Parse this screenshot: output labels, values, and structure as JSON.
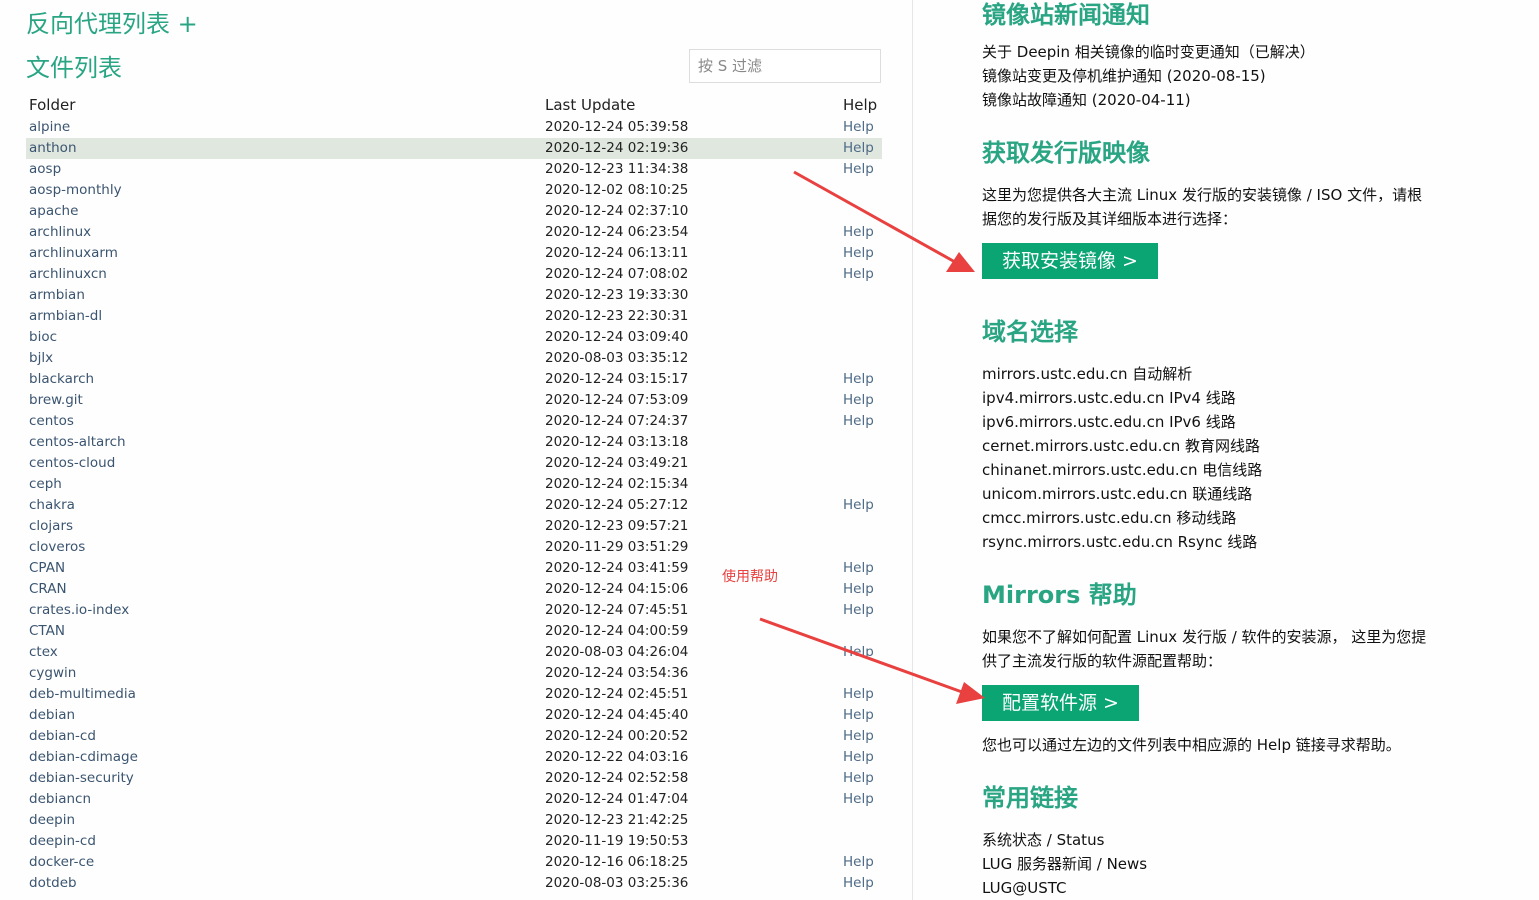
{
  "left": {
    "proxy_title": "反向代理列表 +",
    "files_title": "文件列表",
    "filter_placeholder": "按 S 过滤",
    "headers": {
      "folder": "Folder",
      "last_update": "Last Update",
      "help": "Help"
    },
    "rows": [
      {
        "folder": "alpine",
        "date": "2020-12-24 05:39:58",
        "help": "Help"
      },
      {
        "folder": "anthon",
        "date": "2020-12-24 02:19:36",
        "help": "Help"
      },
      {
        "folder": "aosp",
        "date": "2020-12-23 11:34:38",
        "help": "Help"
      },
      {
        "folder": "aosp-monthly",
        "date": "2020-12-02 08:10:25",
        "help": ""
      },
      {
        "folder": "apache",
        "date": "2020-12-24 02:37:10",
        "help": ""
      },
      {
        "folder": "archlinux",
        "date": "2020-12-24 06:23:54",
        "help": "Help"
      },
      {
        "folder": "archlinuxarm",
        "date": "2020-12-24 06:13:11",
        "help": "Help"
      },
      {
        "folder": "archlinuxcn",
        "date": "2020-12-24 07:08:02",
        "help": "Help"
      },
      {
        "folder": "armbian",
        "date": "2020-12-23 19:33:30",
        "help": ""
      },
      {
        "folder": "armbian-dl",
        "date": "2020-12-23 22:30:31",
        "help": ""
      },
      {
        "folder": "bioc",
        "date": "2020-12-24 03:09:40",
        "help": ""
      },
      {
        "folder": "bjlx",
        "date": "2020-08-03 03:35:12",
        "help": ""
      },
      {
        "folder": "blackarch",
        "date": "2020-12-24 03:15:17",
        "help": "Help"
      },
      {
        "folder": "brew.git",
        "date": "2020-12-24 07:53:09",
        "help": "Help"
      },
      {
        "folder": "centos",
        "date": "2020-12-24 07:24:37",
        "help": "Help"
      },
      {
        "folder": "centos-altarch",
        "date": "2020-12-24 03:13:18",
        "help": ""
      },
      {
        "folder": "centos-cloud",
        "date": "2020-12-24 03:49:21",
        "help": ""
      },
      {
        "folder": "ceph",
        "date": "2020-12-24 02:15:34",
        "help": ""
      },
      {
        "folder": "chakra",
        "date": "2020-12-24 05:27:12",
        "help": "Help"
      },
      {
        "folder": "clojars",
        "date": "2020-12-23 09:57:21",
        "help": ""
      },
      {
        "folder": "cloveros",
        "date": "2020-11-29 03:51:29",
        "help": ""
      },
      {
        "folder": "CPAN",
        "date": "2020-12-24 03:41:59",
        "help": "Help"
      },
      {
        "folder": "CRAN",
        "date": "2020-12-24 04:15:06",
        "help": "Help"
      },
      {
        "folder": "crates.io-index",
        "date": "2020-12-24 07:45:51",
        "help": "Help"
      },
      {
        "folder": "CTAN",
        "date": "2020-12-24 04:00:59",
        "help": ""
      },
      {
        "folder": "ctex",
        "date": "2020-08-03 04:26:04",
        "help": "Help"
      },
      {
        "folder": "cygwin",
        "date": "2020-12-24 03:54:36",
        "help": ""
      },
      {
        "folder": "deb-multimedia",
        "date": "2020-12-24 02:45:51",
        "help": "Help"
      },
      {
        "folder": "debian",
        "date": "2020-12-24 04:45:40",
        "help": "Help"
      },
      {
        "folder": "debian-cd",
        "date": "2020-12-24 00:20:52",
        "help": "Help"
      },
      {
        "folder": "debian-cdimage",
        "date": "2020-12-22 04:03:16",
        "help": "Help"
      },
      {
        "folder": "debian-security",
        "date": "2020-12-24 02:52:58",
        "help": "Help"
      },
      {
        "folder": "debiancn",
        "date": "2020-12-24 01:47:04",
        "help": "Help"
      },
      {
        "folder": "deepin",
        "date": "2020-12-23 21:42:25",
        "help": ""
      },
      {
        "folder": "deepin-cd",
        "date": "2020-11-19 19:50:53",
        "help": ""
      },
      {
        "folder": "docker-ce",
        "date": "2020-12-16 06:18:25",
        "help": "Help"
      },
      {
        "folder": "dotdeb",
        "date": "2020-08-03 03:25:36",
        "help": "Help"
      }
    ],
    "highlighted_row": "anthon"
  },
  "annotation": {
    "label": "使用帮助",
    "color": "#e8413f"
  },
  "right": {
    "news": {
      "title": "镜像站新闻通知",
      "items": [
        "关于 Deepin 相关镜像的临时变更通知（已解决）",
        "镜像站变更及停机维护通知 (2020-08-15)",
        "镜像站故障通知 (2020-04-11)"
      ]
    },
    "iso": {
      "title": "获取发行版映像",
      "desc_line1": "这里为您提供各大主流 Linux 发行版的安装镜像 / ISO 文件，请根",
      "desc_line2": "据您的发行版及其详细版本进行选择：",
      "button": "获取安装镜像 >"
    },
    "domains": {
      "title": "域名选择",
      "items": [
        "mirrors.ustc.edu.cn 自动解析",
        "ipv4.mirrors.ustc.edu.cn IPv4 线路",
        "ipv6.mirrors.ustc.edu.cn IPv6 线路",
        "cernet.mirrors.ustc.edu.cn 教育网线路",
        "chinanet.mirrors.ustc.edu.cn 电信线路",
        "unicom.mirrors.ustc.edu.cn 联通线路",
        "cmcc.mirrors.ustc.edu.cn 移动线路",
        "rsync.mirrors.ustc.edu.cn Rsync 线路"
      ]
    },
    "help": {
      "title": "Mirrors 帮助",
      "desc_line1": "如果您不了解如何配置 Linux 发行版 / 软件的安装源， 这里为您提",
      "desc_line2": "供了主流发行版的软件源配置帮助：",
      "button": "配置软件源 >",
      "note": "您也可以通过左边的文件列表中相应源的 Help 链接寻求帮助。"
    },
    "links": {
      "title": "常用链接",
      "items": [
        "系统状态 / Status",
        "LUG 服务器新闻 / News",
        "LUG@USTC"
      ]
    }
  },
  "colors": {
    "accent": "#2aa584",
    "button": "#0ba574",
    "highlight_row": "#dfe7df",
    "arrow": "#e8413f"
  }
}
